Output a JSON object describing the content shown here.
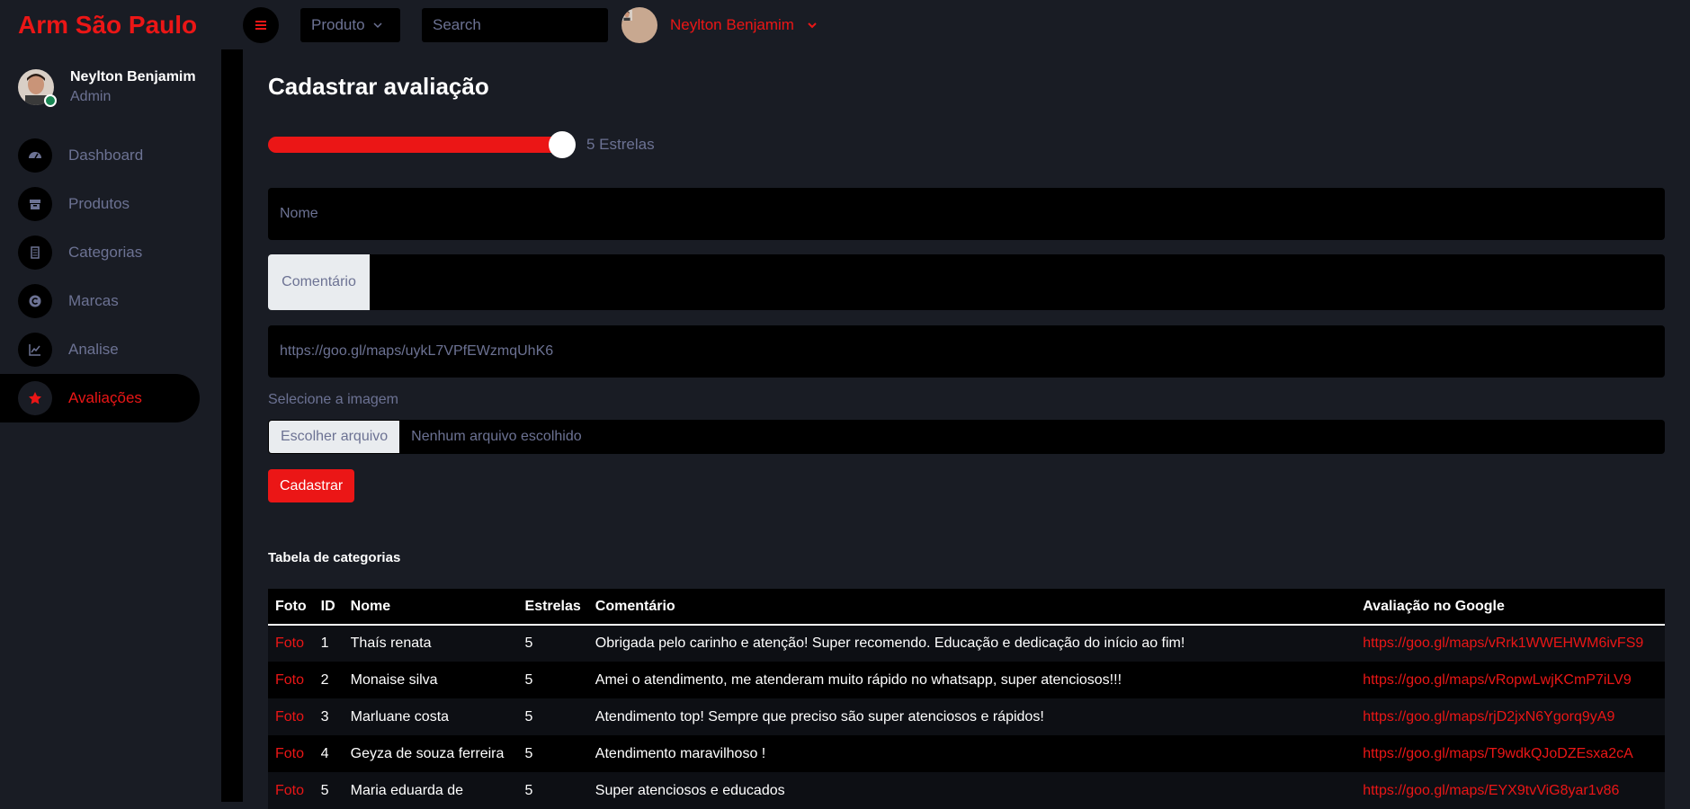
{
  "brand": "Arm São Paulo",
  "navbar": {
    "dropdown_label": "Produto",
    "search_placeholder": "Search",
    "user_name": "Neylton Benjamim"
  },
  "sidebar": {
    "profile": {
      "name": "Neylton Benjamim",
      "role": "Admin"
    },
    "items": [
      {
        "label": "Dashboard",
        "icon": "gauge-icon"
      },
      {
        "label": "Produtos",
        "icon": "box-icon"
      },
      {
        "label": "Categorias",
        "icon": "list-icon"
      },
      {
        "label": "Marcas",
        "icon": "copyright-icon"
      },
      {
        "label": "Analise",
        "icon": "chart-line-icon"
      },
      {
        "label": "Avaliações",
        "icon": "star-icon",
        "active": true
      }
    ]
  },
  "form": {
    "title": "Cadastrar avaliação",
    "rating_label": "5 Estrelas",
    "rating_value": 5,
    "rating_max": 5,
    "name_placeholder": "Nome",
    "comment_label": "Comentário",
    "google_placeholder": "https://goo.gl/maps/uykL7VPfEWzmqUhK6",
    "image_label": "Selecione a imagem",
    "file_button": "Escolher arquivo",
    "file_status": "Nenhum arquivo escolhido",
    "submit_label": "Cadastrar"
  },
  "table": {
    "title": "Tabela de categorias",
    "headers": [
      "Foto",
      "ID",
      "Nome",
      "Estrelas",
      "Comentário",
      "Avaliação no Google"
    ],
    "rows": [
      [
        "Foto",
        "1",
        "Thaís renata",
        "5",
        "Obrigada pelo carinho e atenção! Super recomendo. Educação e dedicação do início ao fim!",
        "https://goo.gl/maps/vRrk1WWEHWM6ivFS9"
      ],
      [
        "Foto",
        "2",
        "Monaise silva",
        "5",
        "Amei o atendimento, me atenderam muito rápido no whatsapp, super atenciosos!!!",
        "https://goo.gl/maps/vRopwLwjKCmP7iLV9"
      ],
      [
        "Foto",
        "3",
        "Marluane costa",
        "5",
        "Atendimento top! Sempre que preciso são super atenciosos e rápidos!",
        "https://goo.gl/maps/rjD2jxN6Ygorq9yA9"
      ],
      [
        "Foto",
        "4",
        "Geyza de souza ferreira",
        "5",
        "Atendimento maravilhoso !",
        "https://goo.gl/maps/T9wdkQJoDZEsxa2cA"
      ],
      [
        "Foto",
        "5",
        "Maria eduarda de",
        "5",
        "Super atenciosos e educados",
        "https://goo.gl/maps/EYX9tvViG8yar1v86"
      ]
    ]
  },
  "colors": {
    "accent": "#eb1616",
    "bg": "#191c24",
    "muted": "#6c7293",
    "online": "#198754"
  }
}
